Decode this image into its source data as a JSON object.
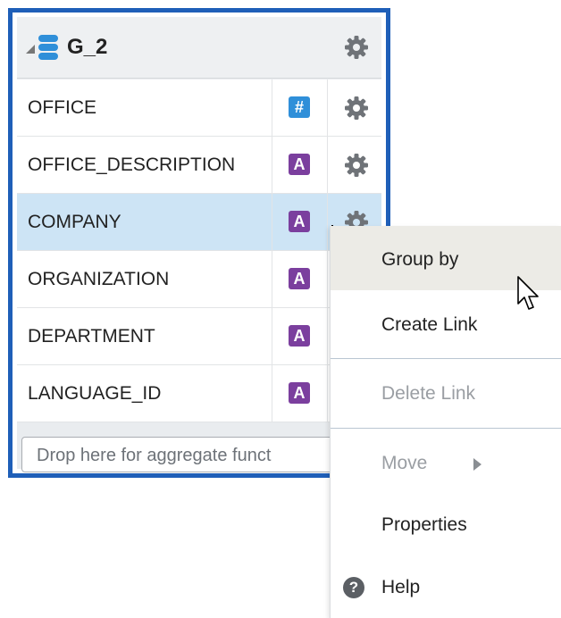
{
  "group": {
    "title": "G_2",
    "icons": {
      "collapse": "triangle-down-icon",
      "source": "database-icon",
      "settings": "gear-icon"
    },
    "rows": [
      {
        "name": "OFFICE",
        "type": "number",
        "badge": "#"
      },
      {
        "name": "OFFICE_DESCRIPTION",
        "type": "alpha",
        "badge": "A"
      },
      {
        "name": "COMPANY",
        "type": "alpha",
        "badge": "A",
        "selected": true
      },
      {
        "name": "ORGANIZATION",
        "type": "alpha",
        "badge": "A"
      },
      {
        "name": "DEPARTMENT",
        "type": "alpha",
        "badge": "A"
      },
      {
        "name": "LANGUAGE_ID",
        "type": "alpha",
        "badge": "A"
      }
    ],
    "drop_placeholder": "Drop here for aggregate funct"
  },
  "context_menu": {
    "items": [
      {
        "label": "Group by",
        "state": "highlighted"
      },
      {
        "label": "Create Link",
        "state": "enabled"
      },
      {
        "label": "Delete Link",
        "state": "disabled"
      },
      {
        "label": "Move",
        "state": "disabled",
        "submenu": true
      },
      {
        "label": "Properties",
        "state": "enabled"
      },
      {
        "label": "Help",
        "state": "enabled",
        "icon": "help-icon"
      }
    ],
    "help_glyph": "?"
  },
  "colors": {
    "panel_border": "#1f5fb8",
    "selected_row": "#cde4f5",
    "number_badge": "#2f8fd9",
    "alpha_badge": "#7b3f9e",
    "menu_highlight": "#ecebe6"
  }
}
